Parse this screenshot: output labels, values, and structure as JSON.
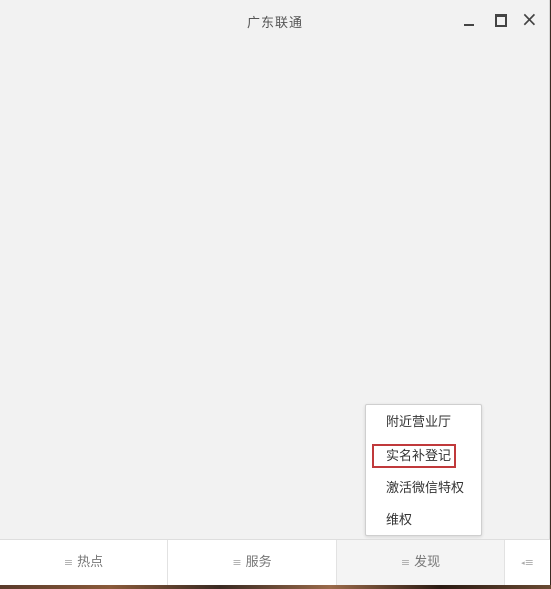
{
  "window": {
    "title": "广东联通",
    "controls": {
      "minimize": "minimize-icon",
      "maximize": "maximize-icon",
      "close": "×"
    }
  },
  "popup_menu": {
    "items": [
      {
        "label": "附近营业厅",
        "highlighted": false
      },
      {
        "label": "实名补登记",
        "highlighted": true
      },
      {
        "label": "激活微信特权",
        "highlighted": false
      },
      {
        "label": "维权",
        "highlighted": false
      }
    ],
    "highlight_color": "#c0393b"
  },
  "bottom_nav": {
    "menu_glyph": "≡",
    "tabs": [
      {
        "label": "热点",
        "icon": "menu-lines-icon"
      },
      {
        "label": "服务",
        "icon": "menu-lines-icon"
      },
      {
        "label": "发现",
        "icon": "menu-lines-icon",
        "active": true
      }
    ],
    "collapse": {
      "arrow": "◂",
      "icon": "collapse-menu-icon"
    }
  }
}
